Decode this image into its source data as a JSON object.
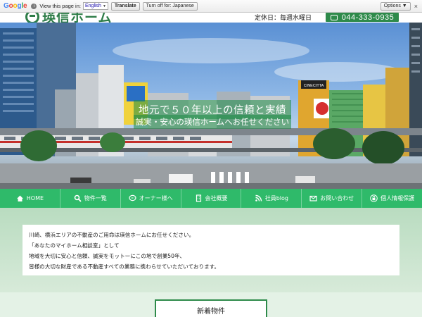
{
  "translate_bar": {
    "logo": "Google",
    "view_text": "View this page in:",
    "language": "English",
    "translate_button": "Translate",
    "turn_off_button": "Turn off for: Japanese",
    "options_button": "Options ▼",
    "close": "×"
  },
  "header": {
    "logo_text": "瑛信ホーム",
    "holiday": "定休日：毎週水曜日",
    "phone": "044-333-0935"
  },
  "hero": {
    "headline": "地元で５０年以上の信頼と実績",
    "subline": "誠実・安心の瑛信ホームへお任せください",
    "sign_text": "CINECITTA"
  },
  "nav": {
    "items": [
      {
        "label": "HOME",
        "icon": "home-icon"
      },
      {
        "label": "物件一覧",
        "icon": "search-icon"
      },
      {
        "label": "オーナー様へ",
        "icon": "chat-icon"
      },
      {
        "label": "会社概要",
        "icon": "building-icon"
      },
      {
        "label": "社員blog",
        "icon": "blog-icon"
      },
      {
        "label": "お問い合わせ",
        "icon": "mail-icon"
      },
      {
        "label": "個人情報保護",
        "icon": "lock-icon"
      }
    ]
  },
  "greeting": {
    "lines": [
      "川崎、横浜エリアの不動産のご用命は瑛信ホームにお任せください。",
      "「あなたのマイホーム相談室」として",
      "地域を大切に安心と信頼、誠実をモットーにこの地で創業50年、",
      "皆様の大切な財産である不動産すべての業務に携わらせていただいております。"
    ]
  },
  "section": {
    "new_listings": "新着物件"
  },
  "colors": {
    "brand_green": "#2e8a4a",
    "nav_green": "#2fba6a"
  }
}
